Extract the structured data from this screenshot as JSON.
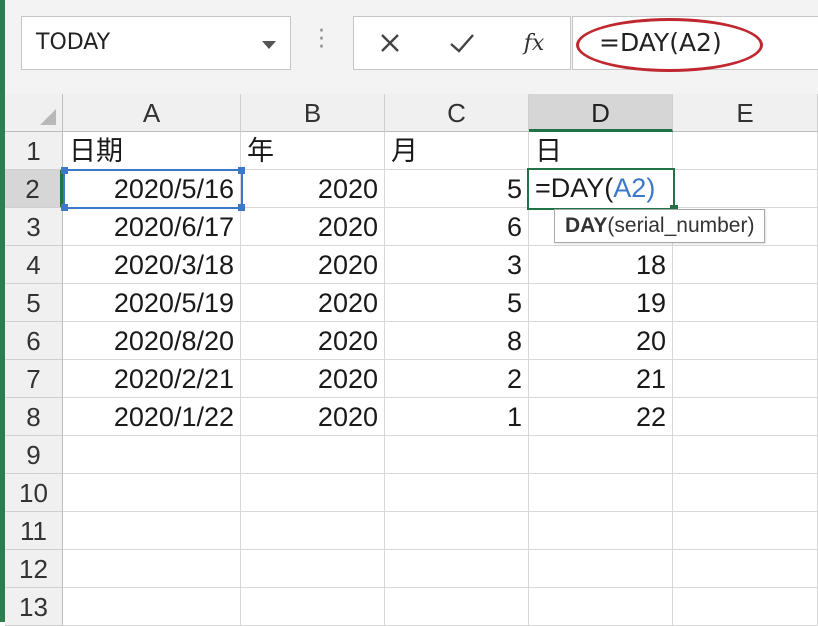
{
  "namebox": {
    "value": "TODAY"
  },
  "formula_bar": {
    "cancel_icon": "close-icon",
    "enter_icon": "check-icon",
    "fx_label": "fx",
    "formula": "=DAY(A2)"
  },
  "columns": [
    "A",
    "B",
    "C",
    "D",
    "E"
  ],
  "rows": [
    "1",
    "2",
    "3",
    "4",
    "5",
    "6",
    "7",
    "8",
    "9",
    "10",
    "11",
    "12",
    "13"
  ],
  "cells": {
    "header": [
      "日期",
      "年",
      "月",
      "日"
    ],
    "data": [
      [
        "2020/5/16",
        "2020",
        "5",
        "=DAY(A2)"
      ],
      [
        "2020/6/17",
        "2020",
        "6",
        ""
      ],
      [
        "2020/3/18",
        "2020",
        "3",
        "18"
      ],
      [
        "2020/5/19",
        "2020",
        "5",
        "19"
      ],
      [
        "2020/8/20",
        "2020",
        "8",
        "20"
      ],
      [
        "2020/2/21",
        "2020",
        "2",
        "21"
      ],
      [
        "2020/1/22",
        "2020",
        "1",
        "22"
      ]
    ]
  },
  "editing_cell": {
    "prefix": "=DAY(",
    "ref": "A2",
    "suffix": ")"
  },
  "tooltip": {
    "func": "DAY",
    "args": "(serial_number)"
  },
  "colors": {
    "accent_green": "#217346",
    "ref_blue": "#3b78c8",
    "oval_red": "#c0282f"
  }
}
